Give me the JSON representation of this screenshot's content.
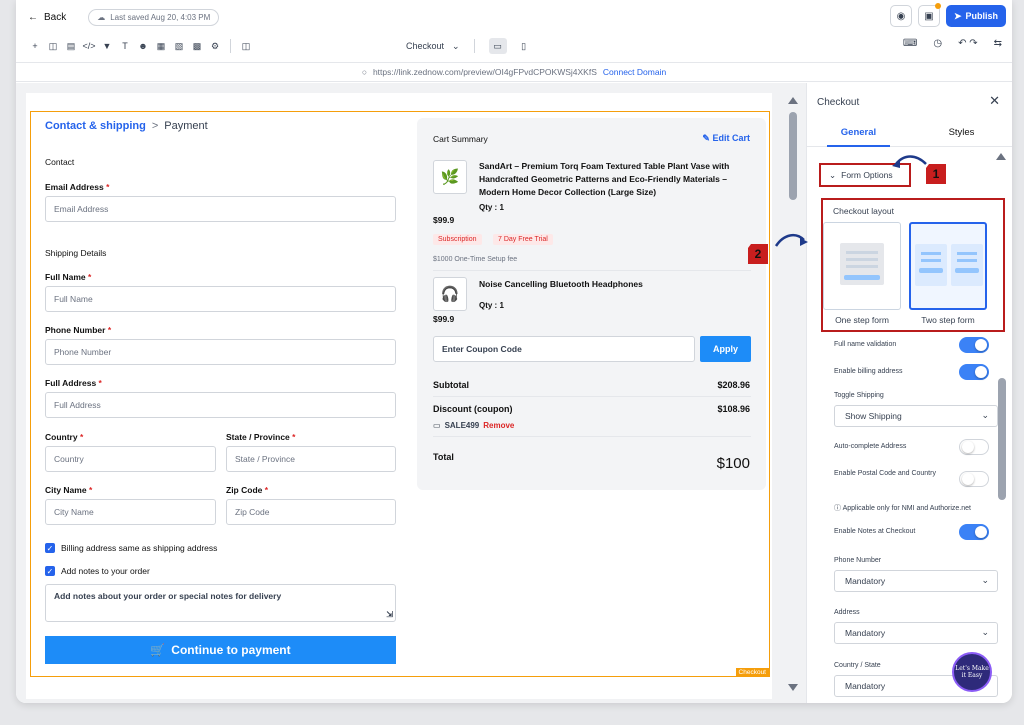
{
  "topbar": {
    "back_label": "Back",
    "saved_label": "Last saved Aug 20, 4:03 PM",
    "publish_label": "Publish"
  },
  "toolbar": {
    "page_select": "Checkout"
  },
  "urlbar": {
    "url": "https://link.zednow.com/preview/OI4gFPvdCPOKWSj4XKfS",
    "connect_label": "Connect Domain"
  },
  "canvas": {
    "frame_tag": "Checkout",
    "breadcrumb": {
      "active": "Contact & shipping",
      "separator": ">",
      "next": "Payment"
    },
    "contact_heading": "Contact",
    "shipping_heading": "Shipping Details",
    "fields": {
      "email": {
        "label": "Email Address",
        "placeholder": "Email Address"
      },
      "full_name": {
        "label": "Full Name",
        "placeholder": "Full Name"
      },
      "phone": {
        "label": "Phone Number",
        "placeholder": "Phone Number"
      },
      "address": {
        "label": "Full Address",
        "placeholder": "Full Address"
      },
      "country": {
        "label": "Country",
        "placeholder": "Country"
      },
      "state": {
        "label": "State / Province",
        "placeholder": "State / Province"
      },
      "city": {
        "label": "City Name",
        "placeholder": "City Name"
      },
      "zip": {
        "label": "Zip Code",
        "placeholder": "Zip Code"
      }
    },
    "required_mark": "*",
    "billing_same_label": "Billing address same as shipping address",
    "add_notes_label": "Add notes to your order",
    "notes_placeholder": "Add notes about your order or special notes for delivery",
    "cta_label": "Continue to payment"
  },
  "cart": {
    "heading": "Cart Summary",
    "edit_label": "Edit Cart",
    "products": [
      {
        "name": "SandArt – Premium Torq Foam Textured Table Plant Vase with Handcrafted Geometric Patterns and Eco-Friendly Materials – Modern Home Decor Collection (Large Size)",
        "qty": "Qty : 1",
        "price": "$99.9",
        "badges": [
          "Subscription",
          "7 Day Free Trial"
        ],
        "fee": "$1000 One-Time Setup fee",
        "icon": "plant-icon"
      },
      {
        "name": "Noise Cancelling Bluetooth Headphones",
        "qty": "Qty : 1",
        "price": "$99.9",
        "icon": "headphones-icon"
      }
    ],
    "coupon_placeholder": "Enter Coupon Code",
    "apply_label": "Apply",
    "subtotal_label": "Subtotal",
    "subtotal_value": "$208.96",
    "discount_label": "Discount (coupon)",
    "discount_value": "$108.96",
    "coupon_code": "SALE499",
    "remove_label": "Remove",
    "total_label": "Total",
    "total_value": "$100"
  },
  "panel": {
    "title": "Checkout",
    "tabs": [
      "General",
      "Styles"
    ],
    "form_options_label": "Form Options",
    "checkout_layout_label": "Checkout layout",
    "layouts": [
      "One step form",
      "Two step form"
    ],
    "selected_layout": "Two step form",
    "options": [
      {
        "label": "Full name validation",
        "on": true
      },
      {
        "label": "Enable billing address",
        "on": true
      }
    ],
    "toggle_shipping_label": "Toggle Shipping",
    "toggle_shipping_value": "Show Shipping",
    "autocomplete_label": "Auto-complete Address",
    "autocomplete_on": false,
    "postal_label": "Enable Postal Code and Country",
    "postal_on": false,
    "info_text": "Applicable only for NMI and Authorize.net",
    "notes_label": "Enable Notes at Checkout",
    "notes_on": true,
    "phone_label": "Phone Number",
    "phone_value": "Mandatory",
    "address_label": "Address",
    "address_value": "Mandatory",
    "country_label": "Country / State",
    "country_value": "Mandatory"
  },
  "annotations": [
    "1",
    "2"
  ],
  "chat_widget_text": "Let's Make it Easy",
  "colors": {
    "accent": "#2563eb",
    "cta": "#1d8cf8",
    "frame": "#f59e0b",
    "annotation": "#b91c1c"
  }
}
